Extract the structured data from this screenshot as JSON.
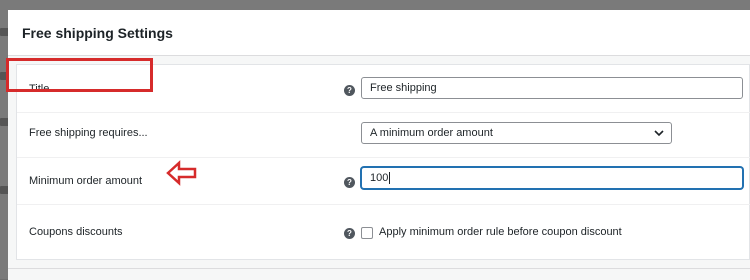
{
  "modal": {
    "title": "Free shipping Settings"
  },
  "fields": {
    "title": {
      "label": "Title",
      "value": "Free shipping",
      "help_icon": "help-icon"
    },
    "requires": {
      "label": "Free shipping requires...",
      "selected": "A minimum order amount",
      "icon": "chevron-down-icon"
    },
    "min_amount": {
      "label": "Minimum order amount",
      "value": "100",
      "help_icon": "help-icon"
    },
    "coupons": {
      "label": "Coupons discounts",
      "checkbox_label": "Apply minimum order rule before coupon discount",
      "checked": false,
      "help_icon": "help-icon"
    }
  },
  "annotations": {
    "highlight_color": "#d62b2b",
    "arrow_icon": "left-arrow-outline-icon"
  },
  "colors": {
    "focus": "#2271b1",
    "border": "#8c8f94",
    "text": "#1d2327"
  }
}
